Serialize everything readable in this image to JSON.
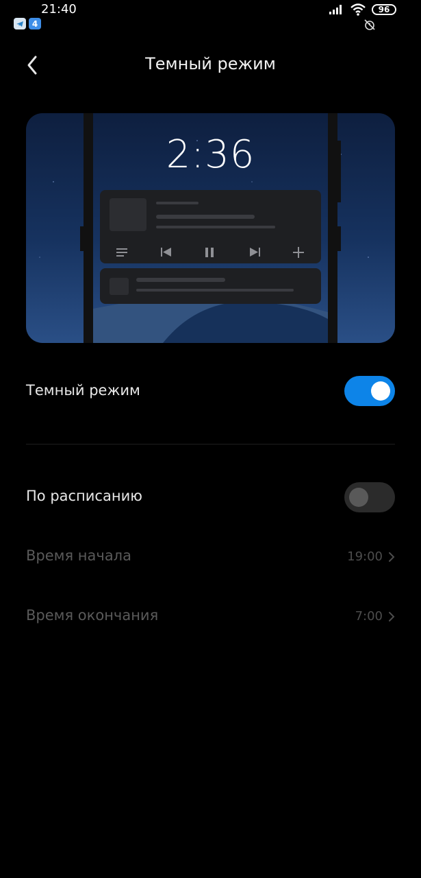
{
  "status_bar": {
    "time": "21:40",
    "battery": "96",
    "notif_badge": "4"
  },
  "header": {
    "title": "Темный режим"
  },
  "preview": {
    "clock": "2:36"
  },
  "settings": {
    "dark_mode": {
      "label": "Темный режим",
      "enabled": true
    },
    "schedule": {
      "label": "По расписанию",
      "enabled": false
    },
    "start_time": {
      "label": "Время начала",
      "value": "19:00"
    },
    "end_time": {
      "label": "Время окончания",
      "value": "7:00"
    }
  },
  "colors": {
    "accent": "#0d84e8",
    "background": "#000000"
  }
}
